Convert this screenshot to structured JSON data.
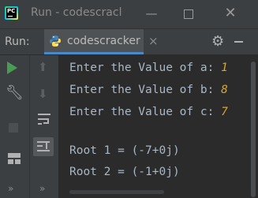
{
  "window": {
    "title": "Run - codescracl",
    "minimize": "—",
    "close": "✕"
  },
  "runbar": {
    "label": "Run:",
    "tab_label": "codescracker",
    "tab_close": "×"
  },
  "console": {
    "lines": [
      {
        "prompt": "Enter the Value of a: ",
        "input": "1"
      },
      {
        "prompt": "Enter the Value of b: ",
        "input": "8"
      },
      {
        "prompt": "Enter the Value of c: ",
        "input": "7"
      }
    ],
    "output": [
      "Root 1 = (-7+0j)",
      "Root 2 = (-1+0j)"
    ]
  },
  "toolbar": {
    "more_left": "»",
    "more_right": "»"
  },
  "colors": {
    "accent": "#4a88c7",
    "run_green": "#499c54",
    "input_yellow": "#d6a535",
    "console_text": "#a9b7c6"
  }
}
